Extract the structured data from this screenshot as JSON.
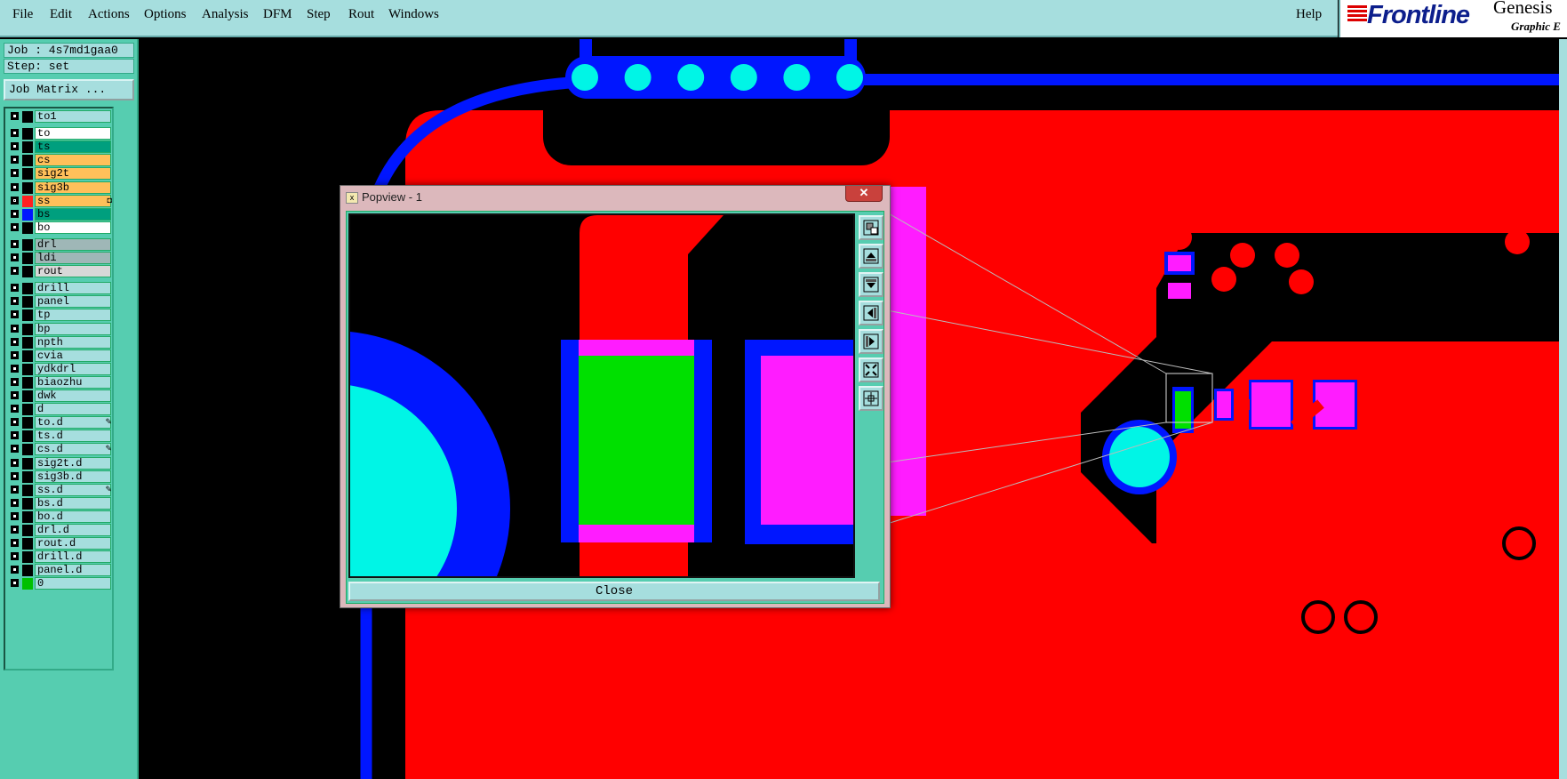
{
  "menubar": {
    "items": [
      "File",
      "Edit",
      "Actions",
      "Options",
      "Analysis",
      "DFM",
      "Step",
      "Rout",
      "Windows"
    ],
    "help": "Help"
  },
  "brand": {
    "name": "Frontline",
    "product": "Genesis",
    "subtitle": "Graphic E"
  },
  "job": {
    "job_line": "Job : 4s7md1gaa0",
    "step_line": "Step: set",
    "matrix_button": "Job Matrix ..."
  },
  "layers": [
    {
      "name": "to1",
      "color": "#a6dede",
      "swatch": "#000000",
      "group": 0
    },
    {
      "name": "to",
      "color": "#ffffff",
      "swatch": "#000000",
      "group": 1
    },
    {
      "name": "ts",
      "color": "#009f7e",
      "swatch": "#000000",
      "group": 1
    },
    {
      "name": "cs",
      "color": "#ffc05a",
      "swatch": "#000000",
      "group": 1
    },
    {
      "name": "sig2t",
      "color": "#ffc05a",
      "swatch": "#000000",
      "group": 1
    },
    {
      "name": "sig3b",
      "color": "#ffc05a",
      "swatch": "#000000",
      "group": 1
    },
    {
      "name": "ss",
      "color": "#ffc05a",
      "swatch": "#ff2020",
      "group": 1,
      "work": true,
      "flag": "◘"
    },
    {
      "name": "bs",
      "color": "#009f7e",
      "swatch": "#0016ff",
      "group": 1
    },
    {
      "name": "bo",
      "color": "#ffffff",
      "swatch": "#000000",
      "group": 1
    },
    {
      "name": "drl",
      "color": "#9fb7b7",
      "swatch": "#000000",
      "group": 2
    },
    {
      "name": "ldi",
      "color": "#9fb7b7",
      "swatch": "#000000",
      "group": 2
    },
    {
      "name": "rout",
      "color": "#d8d8d8",
      "swatch": "#000000",
      "group": 2
    },
    {
      "name": "drill",
      "color": "#a6dede",
      "swatch": "#000000",
      "group": 3
    },
    {
      "name": "panel",
      "color": "#a6dede",
      "swatch": "#000000",
      "group": 3
    },
    {
      "name": "tp",
      "color": "#a6dede",
      "swatch": "#000000",
      "group": 3
    },
    {
      "name": "bp",
      "color": "#a6dede",
      "swatch": "#000000",
      "group": 3
    },
    {
      "name": "npth",
      "color": "#a6dede",
      "swatch": "#000000",
      "group": 3
    },
    {
      "name": "cvia",
      "color": "#a6dede",
      "swatch": "#000000",
      "group": 3
    },
    {
      "name": "ydkdrl",
      "color": "#a6dede",
      "swatch": "#000000",
      "group": 3
    },
    {
      "name": "biaozhu",
      "color": "#a6dede",
      "swatch": "#000000",
      "group": 3
    },
    {
      "name": "dwk",
      "color": "#a6dede",
      "swatch": "#000000",
      "group": 3
    },
    {
      "name": "d",
      "color": "#a6dede",
      "swatch": "#000000",
      "group": 3
    },
    {
      "name": "to.d",
      "color": "#a6dede",
      "swatch": "#000000",
      "group": 3,
      "flag": "✎"
    },
    {
      "name": "ts.d",
      "color": "#a6dede",
      "swatch": "#000000",
      "group": 3
    },
    {
      "name": "cs.d",
      "color": "#a6dede",
      "swatch": "#000000",
      "group": 3,
      "flag": "✎"
    },
    {
      "name": "sig2t.d",
      "color": "#a6dede",
      "swatch": "#000000",
      "group": 3
    },
    {
      "name": "sig3b.d",
      "color": "#a6dede",
      "swatch": "#000000",
      "group": 3
    },
    {
      "name": "ss.d",
      "color": "#a6dede",
      "swatch": "#000000",
      "group": 3,
      "flag": "✎"
    },
    {
      "name": "bs.d",
      "color": "#a6dede",
      "swatch": "#000000",
      "group": 3
    },
    {
      "name": "bo.d",
      "color": "#a6dede",
      "swatch": "#000000",
      "group": 3
    },
    {
      "name": "drl.d",
      "color": "#a6dede",
      "swatch": "#000000",
      "group": 3
    },
    {
      "name": "rout.d",
      "color": "#a6dede",
      "swatch": "#000000",
      "group": 3
    },
    {
      "name": "drill.d",
      "color": "#a6dede",
      "swatch": "#000000",
      "group": 3
    },
    {
      "name": "panel.d",
      "color": "#a6dede",
      "swatch": "#000000",
      "group": 3
    },
    {
      "name": "0",
      "color": "#a6dede",
      "swatch": "#00c000",
      "group": 3
    }
  ],
  "popview": {
    "title": "Popview - 1",
    "close_x": "✕",
    "close_button": "Close",
    "tools": [
      "zoom-area-icon",
      "pan-up-icon",
      "pan-down-icon",
      "pan-left-icon",
      "pan-right-icon",
      "zoom-fit-icon",
      "zoom-center-icon"
    ]
  },
  "colors": {
    "copper": "#ff0000",
    "solder_mask": "#0016ff",
    "pad": "#ff1cff",
    "drill": "#00f5e6",
    "selected": "#00e000",
    "ui_bg": "#56cdb0",
    "ui_field": "#a6dede"
  }
}
